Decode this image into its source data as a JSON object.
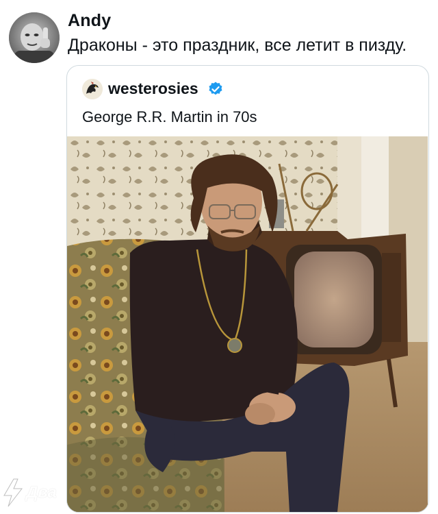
{
  "tweet": {
    "author": "Andy",
    "text": "Драконы - это праздник, все летит в пизду.",
    "avatar_icon": "user-avatar-photo"
  },
  "quote": {
    "author": "westerosies",
    "verified": true,
    "verified_color": "#1d9bf0",
    "text": "George R.R. Martin in 70s",
    "avatar_icon": "dragon-emblem-avatar",
    "photo": "vintage-photo-of-bearded-man-seated-on-sofa"
  },
  "watermark": {
    "text": "Два"
  }
}
